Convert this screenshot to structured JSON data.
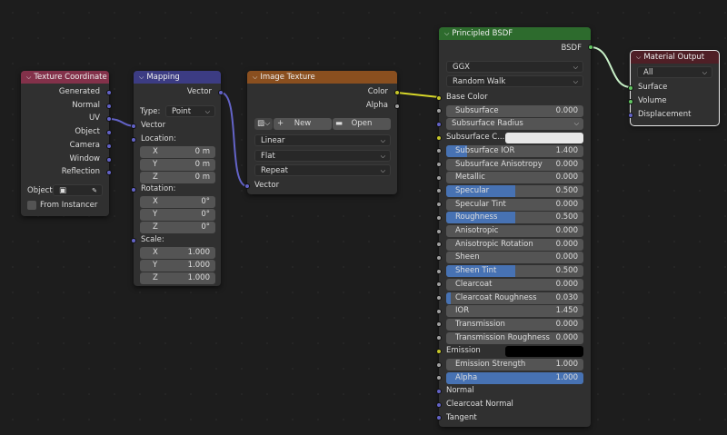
{
  "colors": {
    "vector": "#6363c7",
    "color": "#c7c729",
    "shader": "#63c763",
    "float": "#a1a1a1",
    "accent": "#4772b3"
  },
  "tex_coord": {
    "title": "Texture Coordinate",
    "outputs": [
      "Generated",
      "Normal",
      "UV",
      "Object",
      "Camera",
      "Window",
      "Reflection"
    ],
    "object_label": "Object:",
    "from_instancer": "From Instancer"
  },
  "mapping": {
    "title": "Mapping",
    "output": "Vector",
    "type_label": "Type:",
    "type_value": "Point",
    "input_vector": "Vector",
    "location": {
      "label": "Location:",
      "x": "0 m",
      "y": "0 m",
      "z": "0 m"
    },
    "rotation": {
      "label": "Rotation:",
      "x": "0°",
      "y": "0°",
      "z": "0°"
    },
    "scale": {
      "label": "Scale:",
      "x": "1.000",
      "y": "1.000",
      "z": "1.000"
    },
    "axes": {
      "x": "X",
      "y": "Y",
      "z": "Z"
    }
  },
  "image_texture": {
    "title": "Image Texture",
    "outputs": [
      "Color",
      "Alpha"
    ],
    "new": "New",
    "open": "Open",
    "interpolation": "Linear",
    "projection": "Flat",
    "extension": "Repeat",
    "input": "Vector"
  },
  "bsdf": {
    "title": "Principled BSDF",
    "output": "BSDF",
    "distribution": "GGX",
    "subsurface_method": "Random Walk",
    "rows": [
      {
        "label": "Base Color",
        "kind": "label",
        "sock": "color"
      },
      {
        "label": "Subsurface",
        "value": "0.000",
        "kind": "slider",
        "fill": 0,
        "sock": "float"
      },
      {
        "label": "Subsurface Radius",
        "kind": "drop",
        "sock": "vector"
      },
      {
        "label": "Subsurface C...",
        "kind": "color",
        "swatch": "#e8e8e8",
        "sock": "color"
      },
      {
        "label": "Subsurface IOR",
        "value": "1.400",
        "kind": "slider",
        "fill": 0.15,
        "sock": "float"
      },
      {
        "label": "Subsurface Anisotropy",
        "value": "0.000",
        "kind": "slider",
        "fill": 0,
        "sock": "float"
      },
      {
        "label": "Metallic",
        "value": "0.000",
        "kind": "slider",
        "fill": 0,
        "sock": "float"
      },
      {
        "label": "Specular",
        "value": "0.500",
        "kind": "slider",
        "fill": 0.5,
        "sock": "float"
      },
      {
        "label": "Specular Tint",
        "value": "0.000",
        "kind": "slider",
        "fill": 0,
        "sock": "float"
      },
      {
        "label": "Roughness",
        "value": "0.500",
        "kind": "slider",
        "fill": 0.5,
        "sock": "float"
      },
      {
        "label": "Anisotropic",
        "value": "0.000",
        "kind": "slider",
        "fill": 0,
        "sock": "float"
      },
      {
        "label": "Anisotropic Rotation",
        "value": "0.000",
        "kind": "slider",
        "fill": 0,
        "sock": "float"
      },
      {
        "label": "Sheen",
        "value": "0.000",
        "kind": "slider",
        "fill": 0,
        "sock": "float"
      },
      {
        "label": "Sheen Tint",
        "value": "0.500",
        "kind": "slider",
        "fill": 0.5,
        "sock": "float"
      },
      {
        "label": "Clearcoat",
        "value": "0.000",
        "kind": "slider",
        "fill": 0,
        "sock": "float"
      },
      {
        "label": "Clearcoat Roughness",
        "value": "0.030",
        "kind": "slider",
        "fill": 0.03,
        "sock": "float"
      },
      {
        "label": "IOR",
        "value": "1.450",
        "kind": "slider",
        "fill": 0,
        "sock": "float"
      },
      {
        "label": "Transmission",
        "value": "0.000",
        "kind": "slider",
        "fill": 0,
        "sock": "float"
      },
      {
        "label": "Transmission Roughness",
        "value": "0.000",
        "kind": "slider",
        "fill": 0,
        "sock": "float"
      },
      {
        "label": "Emission",
        "kind": "color",
        "swatch": "#000000",
        "sock": "color"
      },
      {
        "label": "Emission Strength",
        "value": "1.000",
        "kind": "slider",
        "fill": 0,
        "sock": "float"
      },
      {
        "label": "Alpha",
        "value": "1.000",
        "kind": "slider",
        "fill": 1,
        "sock": "float"
      },
      {
        "label": "Normal",
        "kind": "label",
        "sock": "vector"
      },
      {
        "label": "Clearcoat Normal",
        "kind": "label",
        "sock": "vector"
      },
      {
        "label": "Tangent",
        "kind": "label",
        "sock": "vector"
      }
    ]
  },
  "output": {
    "title": "Material Output",
    "target": "All",
    "inputs": [
      "Surface",
      "Volume",
      "Displacement"
    ]
  }
}
